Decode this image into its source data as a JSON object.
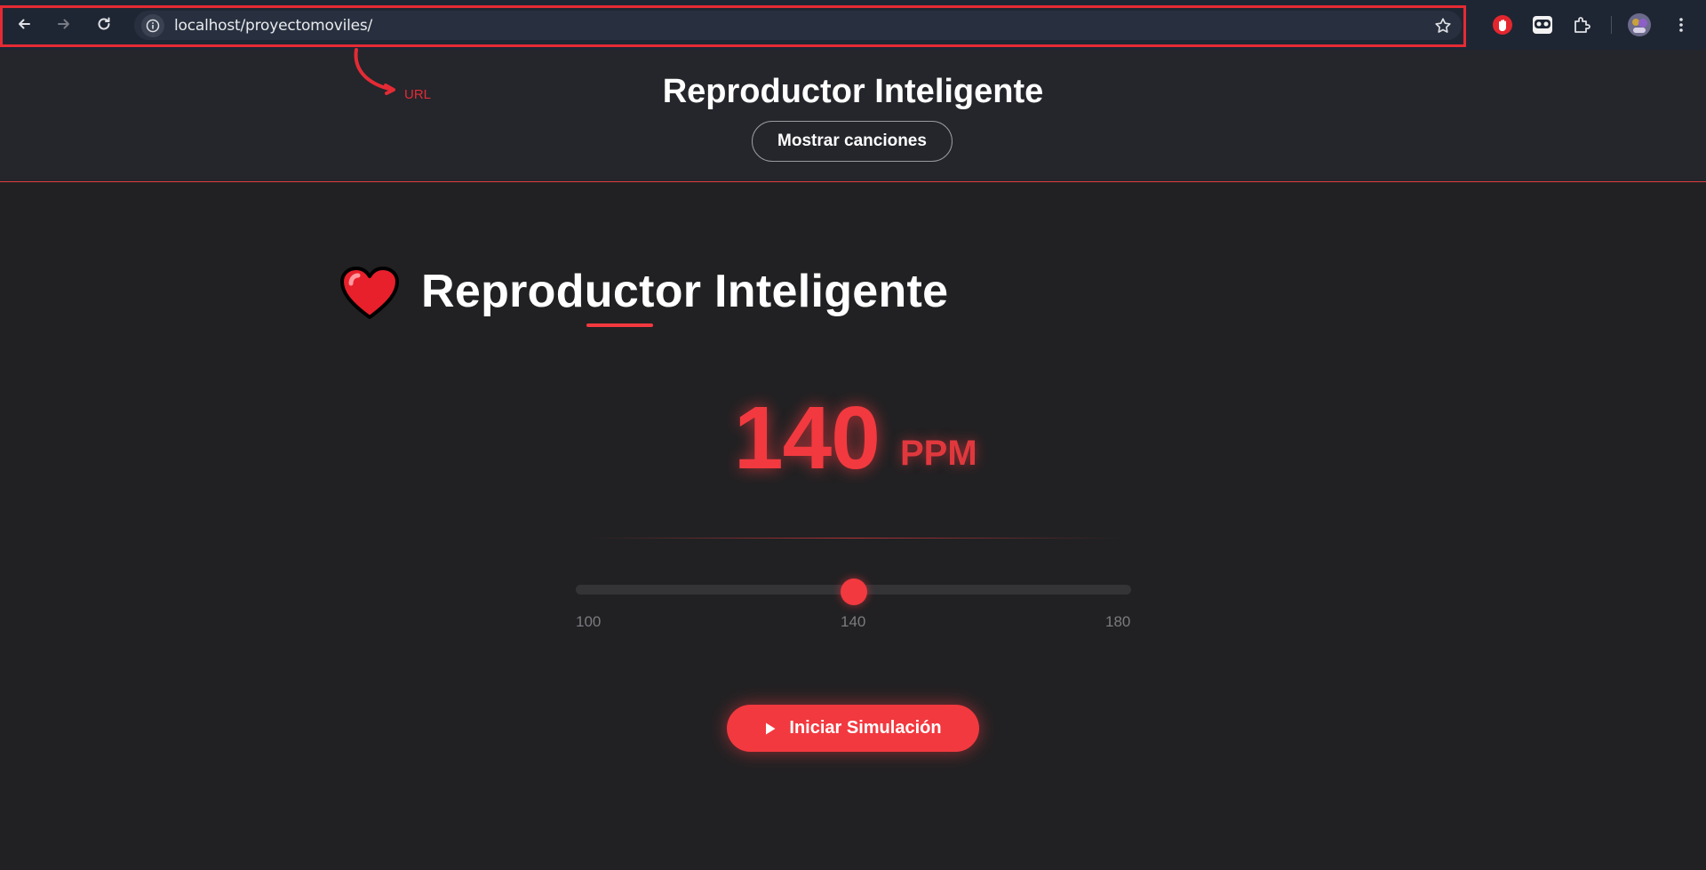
{
  "browser": {
    "url": "localhost/proyectomoviles/",
    "icons": [
      "back-icon",
      "forward-icon",
      "reload-icon",
      "site-info-icon",
      "bookmark-star-icon",
      "extension-stop-icon",
      "extension-mask-icon",
      "extensions-puzzle-icon",
      "profile-avatar",
      "menu-dots-icon"
    ]
  },
  "annotation": {
    "label": "URL",
    "color": "#e42b35"
  },
  "header": {
    "title": "Reproductor Inteligente",
    "songs_button": "Mostrar canciones"
  },
  "main": {
    "heart_icon": "heart-icon",
    "title": "Reproductor Inteligente",
    "bpm_value": "140",
    "bpm_unit": "PPM",
    "slider": {
      "min": 100,
      "max": 180,
      "value": 140,
      "min_label": "100",
      "mid_label": "140",
      "max_label": "180"
    },
    "start_button": {
      "icon": "play-icon",
      "label": "Iniciar Simulación"
    }
  },
  "colors": {
    "accent": "#f2393f",
    "page_background": "#212123",
    "header_background": "#24262b",
    "browser_chrome": "#1f2633"
  }
}
